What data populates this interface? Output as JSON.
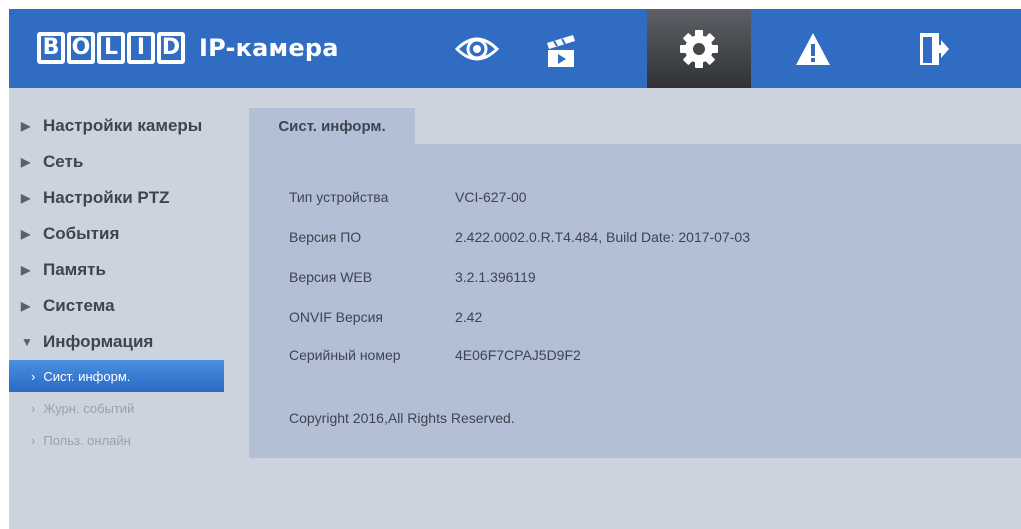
{
  "brand": {
    "logo_letters": [
      "B",
      "O",
      "L",
      "I",
      "D"
    ],
    "product": "IP-камера"
  },
  "nav": [
    {
      "id": "live",
      "icon": "eye-icon"
    },
    {
      "id": "playback",
      "icon": "clapperboard-icon"
    },
    {
      "id": "setup",
      "icon": "gear-icon",
      "active": true
    },
    {
      "id": "alarm",
      "icon": "warning-icon"
    },
    {
      "id": "logout",
      "icon": "logout-icon"
    }
  ],
  "sidebar": {
    "items": [
      {
        "label": "Настройки камеры",
        "expanded": false
      },
      {
        "label": "Сеть",
        "expanded": false
      },
      {
        "label": "Настройки PTZ",
        "expanded": false
      },
      {
        "label": "События",
        "expanded": false
      },
      {
        "label": "Память",
        "expanded": false
      },
      {
        "label": "Система",
        "expanded": false
      },
      {
        "label": "Информация",
        "expanded": true
      }
    ],
    "subitems": [
      {
        "label": "Сист. информ.",
        "active": true
      },
      {
        "label": "Журн. событий",
        "active": false
      },
      {
        "label": "Польз. онлайн",
        "active": false
      }
    ]
  },
  "tab": {
    "label": "Сист. информ."
  },
  "info": {
    "rows": [
      {
        "label": "Тип устройства",
        "value": "VCI-627-00"
      },
      {
        "label": "Версия ПО",
        "value": "2.422.0002.0.R.T4.484, Build Date: 2017-07-03"
      },
      {
        "label": "Версия WEB",
        "value": "3.2.1.396119"
      },
      {
        "label": "ONVIF Версия",
        "value": "2.42"
      },
      {
        "label": "Серийный номер",
        "value": "4E06F7CPAJ5D9F2"
      }
    ],
    "copyright": "Copyright 2016,All Rights Reserved."
  },
  "colors": {
    "header": "#2f6cc2",
    "background": "#ccd3dd",
    "panel": "#b2bfd4",
    "active_sub": "#2a6ac4",
    "text": "#3e4551"
  }
}
